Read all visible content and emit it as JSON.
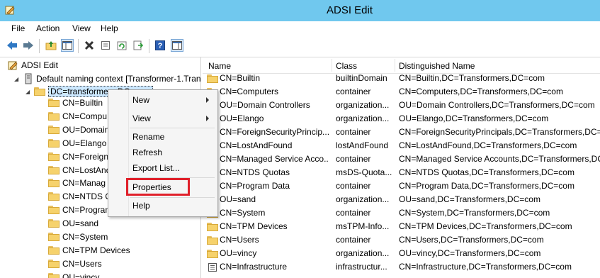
{
  "window": {
    "title": "ADSI Edit",
    "accent": "#70c8ee"
  },
  "menubar": {
    "items": [
      "File",
      "Action",
      "View",
      "Help"
    ]
  },
  "toolbar": {
    "icons": [
      "back-icon",
      "forward-icon",
      "up-folder-icon",
      "show-hide-tree-icon",
      "delete-icon",
      "properties-icon",
      "refresh-icon",
      "export-list-icon",
      "help-icon",
      "show-hide-action-pane-icon"
    ]
  },
  "tree": {
    "root": "ADSI Edit",
    "context": "Default naming context [Transformer-1.Tran",
    "selected": "DC=transformers,DC=com",
    "children": [
      "CN=Builtin",
      "CN=Compu",
      "OU=Domain",
      "OU=Elango",
      "CN=Foreign",
      "CN=LostAnd",
      "CN=Manag",
      "CN=NTDS Q",
      "CN=Program",
      "OU=sand",
      "CN=System",
      "CN=TPM Devices",
      "CN=Users",
      "OU=vincy"
    ]
  },
  "list": {
    "columns": [
      "Name",
      "Class",
      "Distinguished Name"
    ],
    "rows": [
      {
        "name": "CN=Builtin",
        "class": "builtinDomain",
        "dn": "CN=Builtin,DC=Transformers,DC=com",
        "icon": "folder-icon"
      },
      {
        "name": "CN=Computers",
        "class": "container",
        "dn": "CN=Computers,DC=Transformers,DC=com",
        "icon": "folder-icon"
      },
      {
        "name": "OU=Domain Controllers",
        "class": "organization...",
        "dn": "OU=Domain Controllers,DC=Transformers,DC=com",
        "icon": "folder-icon"
      },
      {
        "name": "OU=Elango",
        "class": "organization...",
        "dn": "OU=Elango,DC=Transformers,DC=com",
        "icon": "folder-icon"
      },
      {
        "name": "CN=ForeignSecurityPrincip...",
        "class": "container",
        "dn": "CN=ForeignSecurityPrincipals,DC=Transformers,DC=c",
        "icon": "folder-icon"
      },
      {
        "name": "CN=LostAndFound",
        "class": "lostAndFound",
        "dn": "CN=LostAndFound,DC=Transformers,DC=com",
        "icon": "folder-icon"
      },
      {
        "name": "CN=Managed Service Acco...",
        "class": "container",
        "dn": "CN=Managed Service Accounts,DC=Transformers,DC",
        "icon": "folder-icon"
      },
      {
        "name": "CN=NTDS Quotas",
        "class": "msDS-Quota...",
        "dn": "CN=NTDS Quotas,DC=Transformers,DC=com",
        "icon": "folder-icon"
      },
      {
        "name": "CN=Program Data",
        "class": "container",
        "dn": "CN=Program Data,DC=Transformers,DC=com",
        "icon": "folder-icon"
      },
      {
        "name": "OU=sand",
        "class": "organization...",
        "dn": "OU=sand,DC=Transformers,DC=com",
        "icon": "folder-icon"
      },
      {
        "name": "CN=System",
        "class": "container",
        "dn": "CN=System,DC=Transformers,DC=com",
        "icon": "folder-icon"
      },
      {
        "name": "CN=TPM Devices",
        "class": "msTPM-Info...",
        "dn": "CN=TPM Devices,DC=Transformers,DC=com",
        "icon": "folder-icon"
      },
      {
        "name": "CN=Users",
        "class": "container",
        "dn": "CN=Users,DC=Transformers,DC=com",
        "icon": "folder-icon"
      },
      {
        "name": "OU=vincy",
        "class": "organization...",
        "dn": "OU=vincy,DC=Transformers,DC=com",
        "icon": "folder-icon"
      },
      {
        "name": "CN=Infrastructure",
        "class": "infrastructur...",
        "dn": "CN=Infrastructure,DC=Transformers,DC=com",
        "icon": "document-icon"
      }
    ]
  },
  "context_menu": {
    "items": [
      {
        "label": "New",
        "submenu": true
      },
      {
        "label": "View",
        "submenu": true
      },
      {
        "label": "Rename",
        "submenu": false
      },
      {
        "label": "Refresh",
        "submenu": false
      },
      {
        "label": "Export List...",
        "submenu": false
      },
      {
        "label": "Properties",
        "submenu": false,
        "highlighted": true
      },
      {
        "label": "Help",
        "submenu": false
      }
    ],
    "highlight_color": "#e0202a"
  }
}
